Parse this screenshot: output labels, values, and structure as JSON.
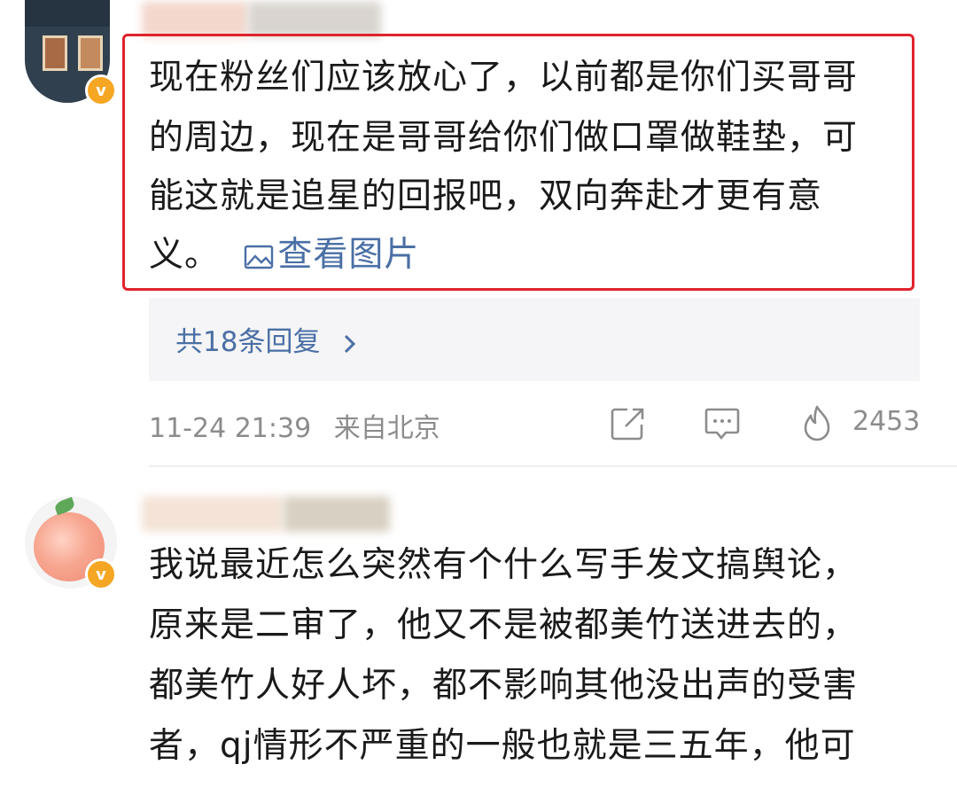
{
  "comment1": {
    "text_lines": [
      "现在粉丝们应该放心了，以前都是你们买哥哥",
      "的周边，现在是哥哥给你们做口罩做鞋垫，可",
      "能这就是追星的回报吧，双向奔赴才更有意",
      "义。"
    ],
    "view_image_label": "查看图片",
    "replies_label": "共18条回复",
    "timestamp": "11-24 21:39",
    "location": "来自北京",
    "like_count": "2453",
    "verified_badge": "v",
    "icons": [
      "share-icon",
      "comment-icon",
      "like-flame-icon",
      "chevron-right-icon",
      "image-icon"
    ]
  },
  "comment2": {
    "text_lines": [
      "我说最近怎么突然有个什么写手发文搞舆论，",
      "原来是二审了，他又不是被都美竹送进去的，",
      "都美竹人好人坏，都不影响其他没出声的受害",
      "者，qj情形不严重的一般也就是三五年，他可"
    ],
    "verified_badge": "v"
  },
  "colors": {
    "highlight_border": "#e0232c",
    "link": "#4a6fa5",
    "meta_text": "#8c8c8c",
    "badge": "#f5a623"
  }
}
